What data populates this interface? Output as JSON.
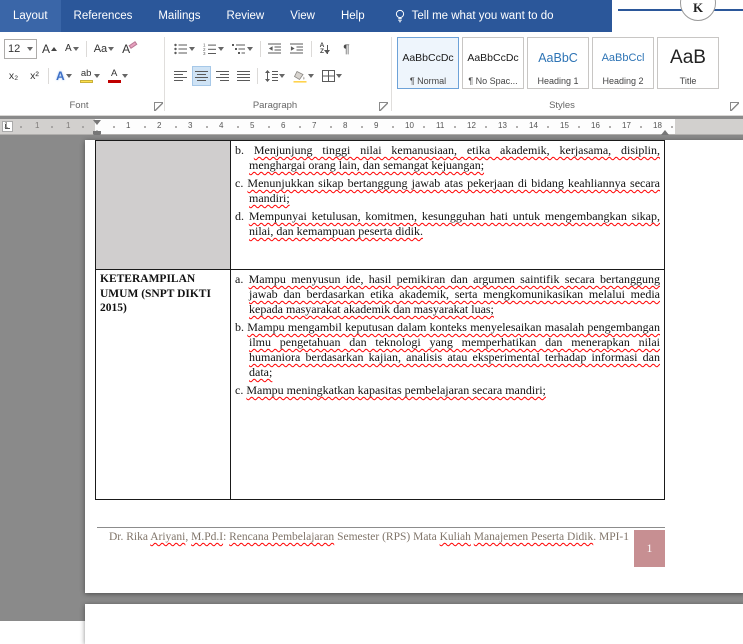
{
  "menu": {
    "tabs": [
      "Layout",
      "References",
      "Mailings",
      "Review",
      "View",
      "Help"
    ],
    "tell_me": "Tell me what you want to do"
  },
  "corner": {
    "avatar_letter": "K"
  },
  "ribbon": {
    "font": {
      "label": "Font",
      "size": "12",
      "grow": "A",
      "shrink": "A",
      "change_case": "Aa",
      "clear": "A",
      "subscript": "x₂",
      "superscript": "x²",
      "effects": "A",
      "highlight": "ab",
      "font_color": "A"
    },
    "paragraph": {
      "label": "Paragraph",
      "pilcrow": "¶",
      "sort_a": "A",
      "sort_z": "Z"
    },
    "styles": {
      "label": "Styles",
      "items": [
        {
          "sample": "AaBbCcDc",
          "name": "¶ Normal"
        },
        {
          "sample": "AaBbCcDc",
          "name": "¶ No Spac..."
        },
        {
          "sample": "AaBbC",
          "name": "Heading 1"
        },
        {
          "sample": "AaBbCcl",
          "name": "Heading 2"
        },
        {
          "sample": "AaB",
          "name": "Title"
        }
      ]
    }
  },
  "ruler": {
    "margin_numbers": [
      "1",
      "1",
      "1"
    ],
    "numbers": [
      1,
      2,
      3,
      4,
      5,
      6,
      7,
      8,
      9,
      10,
      11,
      12,
      13,
      14,
      15,
      16,
      17,
      18
    ]
  },
  "document": {
    "table": {
      "rows": [
        {
          "label": "",
          "items": [
            {
              "n": "b.",
              "text": "Menjunjung tinggi nilai kemanusiaan, etika akademik, kerjasama, disiplin, menghargai orang lain, dan semangat kejuangan;"
            },
            {
              "n": "c.",
              "text": "Menunjukkan sikap bertanggung jawab atas pekerjaan di bidang keahliannya secara mandiri;"
            },
            {
              "n": "d.",
              "text": "Mempunyai ketulusan, komitmen, kesungguhan hati untuk mengembangkan sikap, nilai, dan kemampuan peserta didik."
            }
          ]
        },
        {
          "label": "KETERAMPILAN UMUM (SNPT DIKTI 2015)",
          "items": [
            {
              "n": "a.",
              "text": "Mampu menyusun ide, hasil pemikiran dan argumen saintifik secara bertanggung jawab dan berdasarkan etika akademik, serta mengkomunikasikan melalui media kepada masyarakat akademik dan masyarakat luas;"
            },
            {
              "n": "b.",
              "text": "Mampu mengambil keputusan dalam konteks menyelesaikan masalah pengembangan ilmu pengetahuan dan teknologi yang memperhatikan dan menerapkan nilai humaniora berdasarkan kajian, analisis atau eksperimental terhadap informasi dan data;"
            },
            {
              "n": "c.",
              "text": "Mampu meningkatkan kapasitas pembelajaran secara mandiri;"
            }
          ]
        }
      ]
    },
    "footer": {
      "segments": [
        {
          "t": "Dr. Rika ",
          "m": false
        },
        {
          "t": "Ariyani",
          "m": true
        },
        {
          "t": ", ",
          "m": false
        },
        {
          "t": "M.Pd.I",
          "m": true
        },
        {
          "t": ": ",
          "m": false
        },
        {
          "t": "Rencana Pembelajaran",
          "m": true
        },
        {
          "t": " Semester (RPS) Mata ",
          "m": false
        },
        {
          "t": "Kuliah",
          "m": true
        },
        {
          "t": " ",
          "m": false
        },
        {
          "t": "Manajemen Peserta Didik",
          "m": true
        },
        {
          "t": ". MPI-1",
          "m": false
        }
      ],
      "page_number": "1"
    }
  },
  "colors": {
    "titlebar_blue": "#2b579a",
    "heading_blue": "#2e74b5",
    "spellcheck_red": "#ff0000",
    "page_number_bg": "#c78f92",
    "cell_shading": "#d0cece",
    "canvas_gray": "#8a8a8a"
  }
}
